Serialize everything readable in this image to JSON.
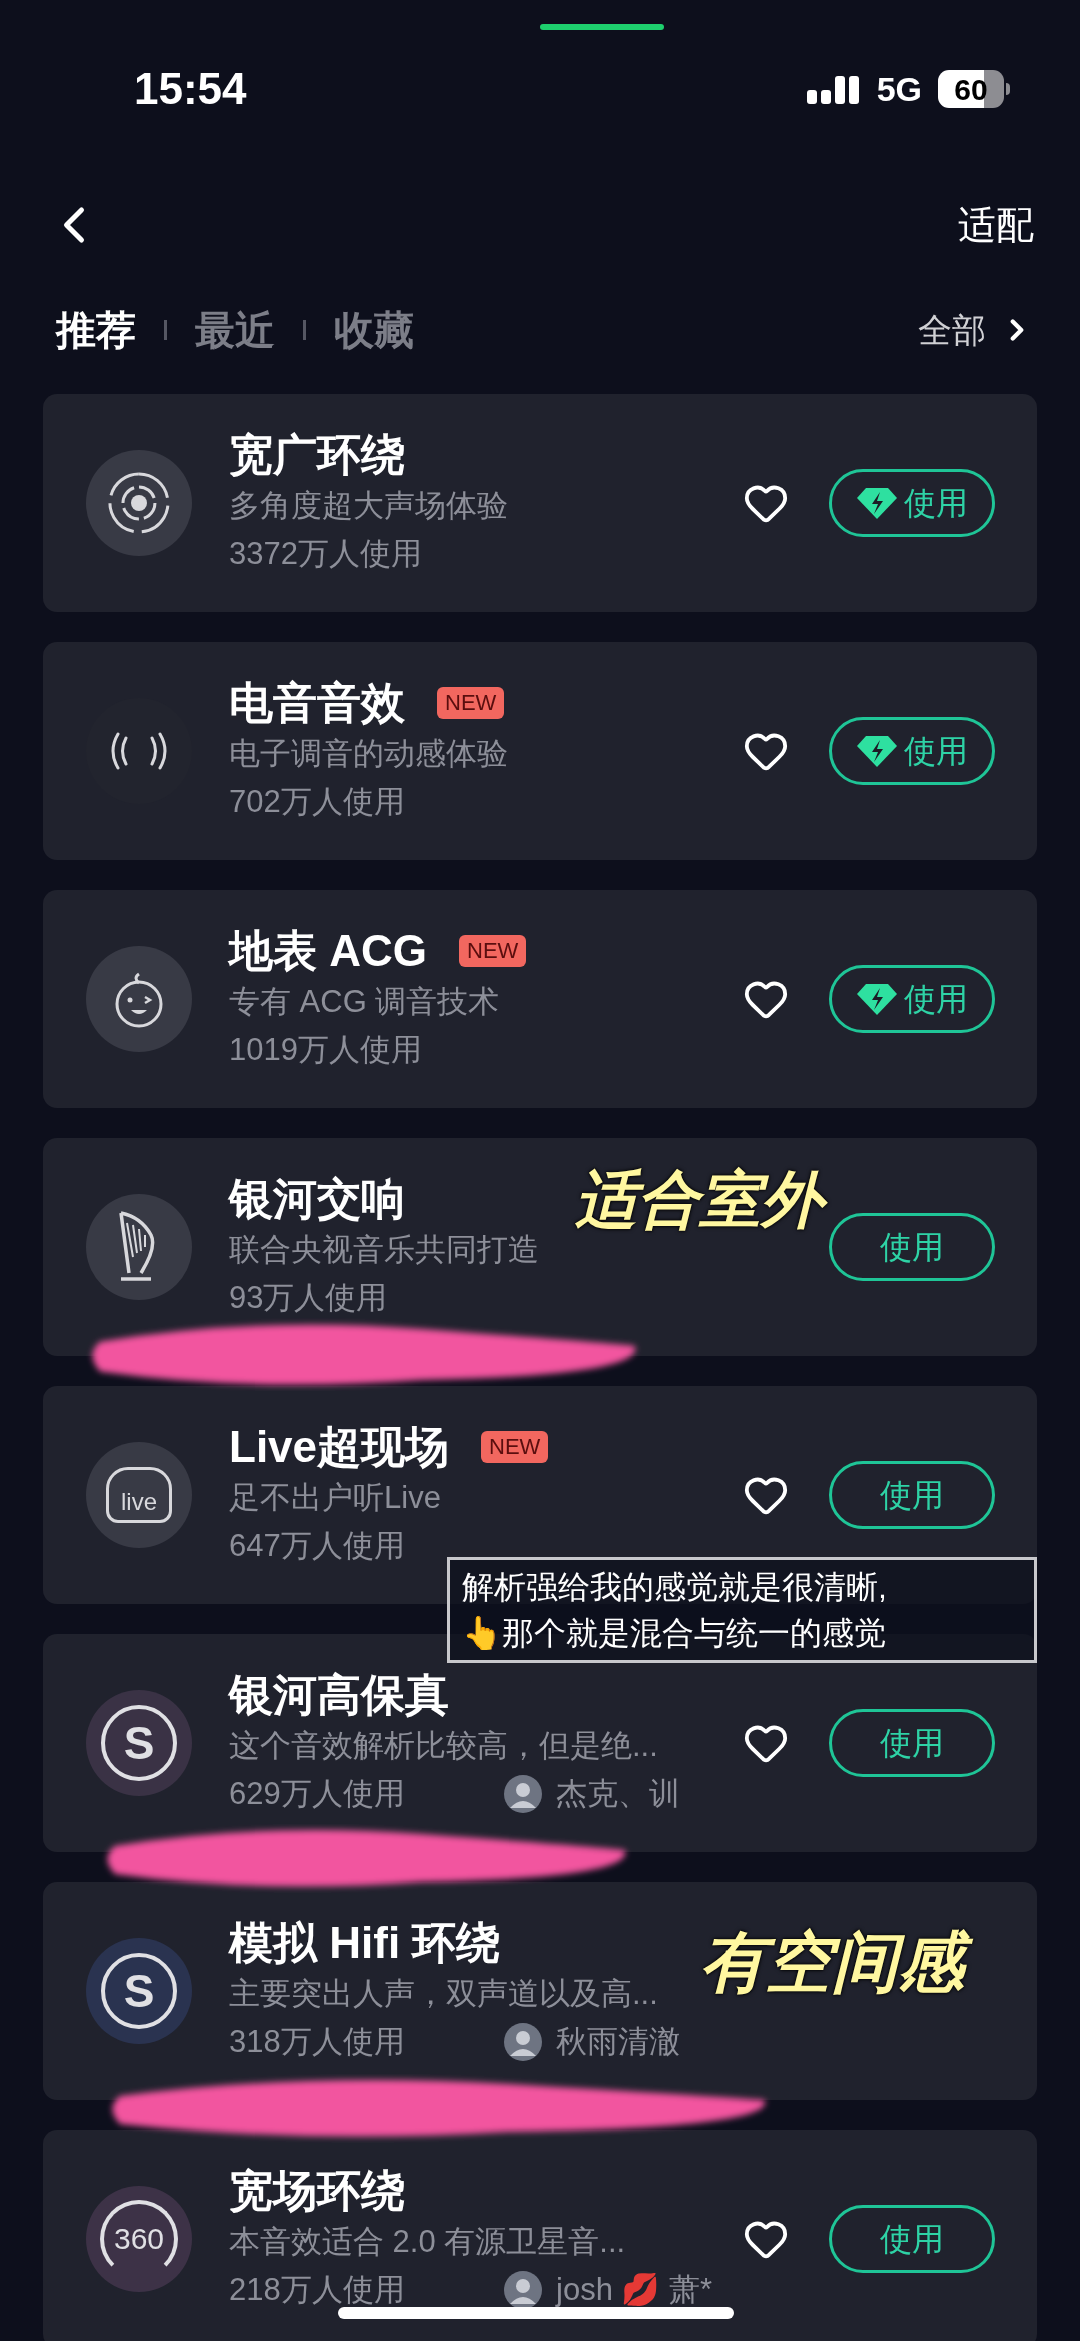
{
  "status_bar": {
    "time": "15:54",
    "network": "5G",
    "battery": "60"
  },
  "nav": {
    "action": "适配"
  },
  "tabs": [
    {
      "label": "推荐",
      "selected": true
    },
    {
      "label": "最近",
      "selected": false
    },
    {
      "label": "收藏",
      "selected": false
    }
  ],
  "all_link": "全部",
  "effects": [
    {
      "title": "宽广环绕",
      "description": "多角度超大声场体验",
      "users": "3372万人使用",
      "icon": {
        "kind": "surround",
        "color": "#383a45"
      },
      "vip": true,
      "favorited": false,
      "button": "使用"
    },
    {
      "title": "电音音效",
      "badge": "NEW",
      "description": "电子调音的动感体验",
      "users": "702万人使用",
      "icon": {
        "kind": "waves",
        "color": "#22242e"
      },
      "vip": true,
      "favorited": false,
      "button": "使用"
    },
    {
      "title": "地表 ACG",
      "badge": "NEW",
      "description": "专有 ACG 调音技术",
      "users": "1019万人使用",
      "icon": {
        "kind": "face",
        "color": "#383a45"
      },
      "vip": true,
      "favorited": false,
      "button": "使用"
    },
    {
      "title": "银河交响",
      "description": "联合央视音乐共同打造",
      "users": "93万人使用",
      "icon": {
        "kind": "harp",
        "color": "#383a45"
      },
      "vip": false,
      "button": "使用"
    },
    {
      "title": "Live超现场",
      "badge": "NEW",
      "description": "足不出户听Live",
      "users": "647万人使用",
      "icon": {
        "kind": "house",
        "label": "live",
        "color": "#383a45"
      },
      "vip": false,
      "favorited": false,
      "button": "使用"
    },
    {
      "title": "银河高保真",
      "description": "这个音效解析比较高，但是绝...",
      "users": "629万人使用",
      "author": "杰克、训",
      "icon": {
        "kind": "letter",
        "label": "S",
        "color": "#3a3245"
      },
      "vip": false,
      "favorited": false,
      "button": "使用"
    },
    {
      "title": "模拟 Hifi 环绕",
      "description": "主要突出人声，双声道以及高...",
      "users": "318万人使用",
      "author": "秋雨清澈",
      "icon": {
        "kind": "letter",
        "label": "S",
        "color": "#2a3350"
      }
    },
    {
      "title": "宽场环绕",
      "description": "本音效适合 2.0 有源卫星音...",
      "users": "218万人使用",
      "author": "josh 💋 萧*",
      "icon": {
        "kind": "ring",
        "label": "360",
        "color": "#3d3247"
      },
      "vip": false,
      "favorited": false,
      "button": "使用"
    }
  ],
  "annotations": [
    {
      "text": "适合室外"
    },
    {
      "text": "有空间感"
    }
  ],
  "caption": [
    "解析强给我的感觉就是很清晰,",
    "👆那个就是混合与统一的感觉"
  ]
}
